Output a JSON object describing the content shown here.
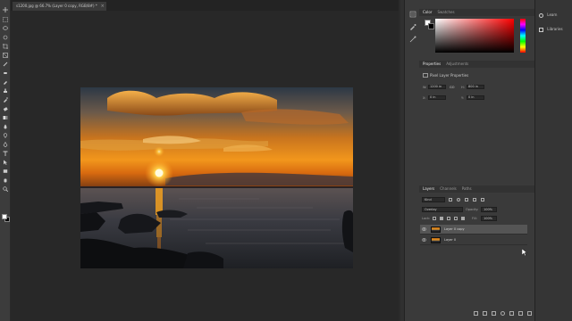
{
  "document": {
    "tab_title": "s1200.jpg @ 66.7% (Layer 0 copy, RGB/8#) *",
    "close_glyph": "×"
  },
  "toolbar": {
    "tools": [
      "move-icon",
      "marquee-icon",
      "lasso-icon",
      "quick-select-icon",
      "crop-icon",
      "frame-icon",
      "eyedropper-icon",
      "healing-icon",
      "brush-icon",
      "stamp-icon",
      "history-brush-icon",
      "eraser-icon",
      "gradient-icon",
      "blur-icon",
      "dodge-icon",
      "pen-icon",
      "type-icon",
      "path-select-icon",
      "rectangle-icon",
      "hand-icon",
      "zoom-icon"
    ]
  },
  "color_panel": {
    "tabs": [
      "Color",
      "Swatches"
    ],
    "active_tab": "Color"
  },
  "properties_panel": {
    "tabs": [
      "Properties",
      "Adjustments"
    ],
    "active_tab": "Properties",
    "title": "Pixel Layer Properties",
    "w_label": "W:",
    "w_value": "1200 in",
    "h_label": "H:",
    "h_value": "800 in",
    "x_label": "X:",
    "x_value": "0 in",
    "y_label": "Y:",
    "y_value": "0 in",
    "link_glyph": "GO"
  },
  "layers_panel": {
    "tabs": [
      "Layers",
      "Channels",
      "Paths"
    ],
    "active_tab": "Layers",
    "filter_kind": "Kind",
    "blend_mode": "Overlay",
    "opacity_label": "Opacity:",
    "opacity_value": "100%",
    "lock_label": "Lock:",
    "fill_label": "Fill:",
    "fill_value": "100%",
    "layers": [
      {
        "name": "Layer 0 copy",
        "visible": true,
        "selected": true
      },
      {
        "name": "Layer 0",
        "visible": true,
        "selected": false
      }
    ]
  },
  "mini_panels": {
    "items": [
      {
        "label": "Learn",
        "icon": "lightbulb-icon"
      },
      {
        "label": "Libraries",
        "icon": "libraries-icon"
      }
    ]
  },
  "colors": {
    "sky_top": "#2f3a4a",
    "sun": "#fff6c8",
    "horizon_orange": "#f28a17",
    "sea": "#3b3c42",
    "accent": "#4a4a4a"
  }
}
